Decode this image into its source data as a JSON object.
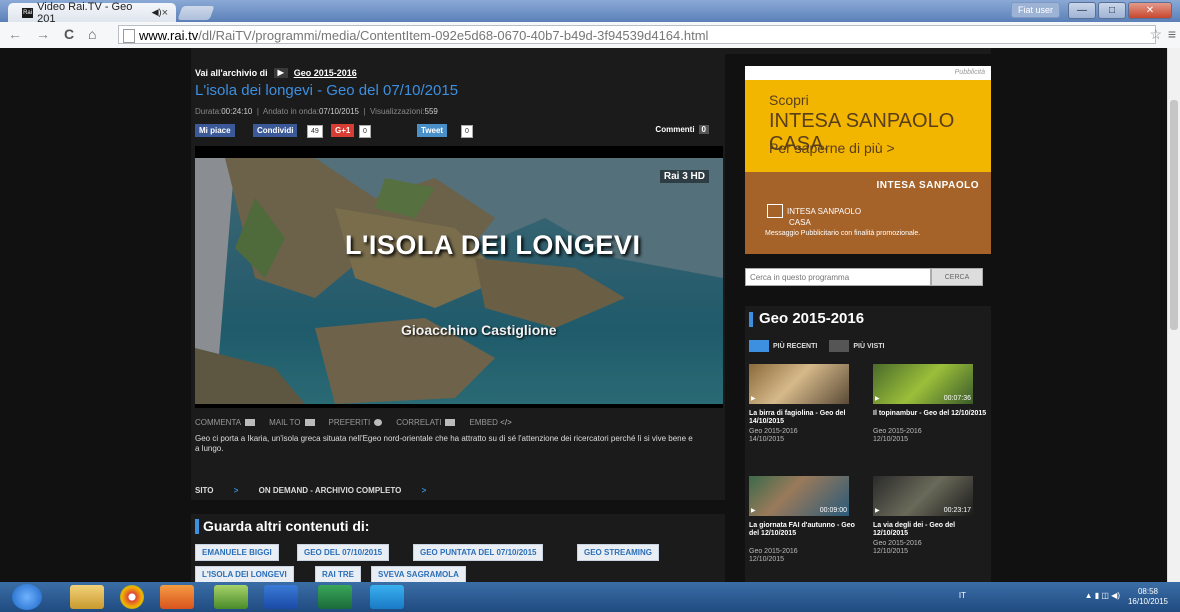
{
  "browser": {
    "tab_title": "Video Rai.TV - Geo 201",
    "tab_close": "×",
    "user_label": "Fiat user",
    "url_host": "www.rai.tv",
    "url_path": "/dl/RaiTV/programmi/media/ContentItem-092e5d68-0670-40b7-b49d-3f94539d4164.html",
    "back": "←",
    "forward": "→",
    "reload": "C",
    "home": "⌂",
    "star": "☆",
    "menu": "≡"
  },
  "main": {
    "breadcrumb_prefix": "Vai all'archivio di",
    "breadcrumb_link": "Geo 2015-2016",
    "title": "L'isola dei longevi - Geo del 07/10/2015",
    "meta": {
      "durata_label": "Durata:",
      "durata": "00:24:10",
      "andato_label": "Andato in onda:",
      "andato": "07/10/2015",
      "views_label": "Visualizzazioni:",
      "views": "559"
    },
    "social": {
      "mipiace": "Mi piace",
      "condividi": "Condividi",
      "fb_count": "49",
      "gplus": "G+1",
      "gplus_count": "0",
      "tweet": "Tweet",
      "tweet_count": "0",
      "commenti": "Commenti",
      "commenti_count": "0"
    },
    "video": {
      "channel_logo": "Rai 3 HD",
      "overlay_title": "L'ISOLA DEI LONGEVI",
      "overlay_subtitle": "Gioacchino Castiglione"
    },
    "tools": [
      "COMMENTA",
      "MAIL TO",
      "PREFERITI",
      "CORRELATI",
      "EMBED"
    ],
    "description": "Geo ci porta a Ikaria, un'isola greca situata nell'Egeo nord-orientale che ha attratto su di sé l'attenzione dei ricercatori perché lì si vive bene e a lungo.",
    "links": {
      "sito": "SITO",
      "ondemand": "ON DEMAND - ARCHIVIO COMPLETO",
      "arrow": ">"
    }
  },
  "guarda": {
    "title": "Guarda altri contenuti di:",
    "tags": [
      "EMANUELE BIGGI",
      "GEO DEL 07/10/2015",
      "GEO PUNTATA DEL 07/10/2015",
      "GEO STREAMING",
      "L'ISOLA DEI LONGEVI",
      "RAI TRE",
      "SVEVA SAGRAMOLA"
    ]
  },
  "sidebar": {
    "ad_label": "Pubblicità",
    "ad_line1": "Scopri",
    "ad_line2": "INTESA SANPAOLO CASA.",
    "ad_line3": "Per saperne di più >",
    "ad_brand": "INTESA SANPAOLO",
    "ad_casa_line1": "INTESA SANPAOLO",
    "ad_casa_line2": "CASA",
    "ad_msg": "Messaggio Pubblicitario con finalità promozionale.",
    "search_placeholder": "Cerca in questo programma",
    "search_button": "CERCA",
    "program_title": "Geo 2015-2016",
    "tab_recent": "PIÙ RECENTI",
    "tab_viewed": "PIÙ VISTI",
    "cards": [
      {
        "title": "La birra di fagiolina - Geo del 14/10/2015",
        "series": "Geo 2015-2016",
        "date": "14/10/2015",
        "duration": ""
      },
      {
        "title": "Il topinambur - Geo del 12/10/2015",
        "series": "Geo 2015-2016",
        "date": "12/10/2015",
        "duration": "00:07:36"
      },
      {
        "title": "La giornata FAI d'autunno - Geo del 12/10/2015",
        "series": "Geo 2015-2016",
        "date": "12/10/2015",
        "duration": "00:09:00"
      },
      {
        "title": "La via degli dei - Geo del 12/10/2015",
        "series": "Geo 2015-2016",
        "date": "12/10/2015",
        "duration": "00:23:17"
      }
    ]
  },
  "taskbar": {
    "lang": "IT",
    "time": "08:58",
    "date": "16/10/2015"
  },
  "colors": {
    "accent": "#3d8fe0",
    "ad_yellow": "#f2b600",
    "ad_brown": "#a5632a"
  }
}
